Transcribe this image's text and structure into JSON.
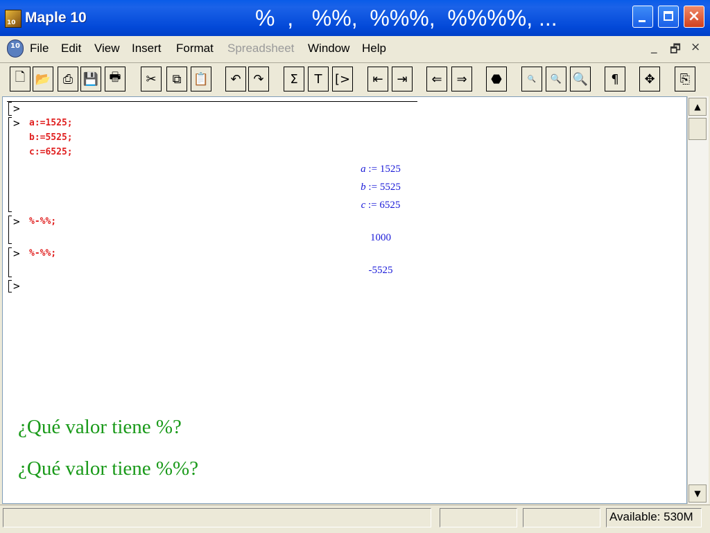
{
  "window": {
    "title": "Maple 10",
    "app_icon_text": "10",
    "slide_title": "%  ,   %%,  %%%,  %%%%, ..."
  },
  "menu": {
    "items": [
      {
        "label": "File",
        "enabled": true
      },
      {
        "label": "Edit",
        "enabled": true
      },
      {
        "label": "View",
        "enabled": true
      },
      {
        "label": "Insert",
        "enabled": true
      },
      {
        "label": "Format",
        "enabled": true
      },
      {
        "label": "Spreadsheet",
        "enabled": false
      },
      {
        "label": "Window",
        "enabled": true
      },
      {
        "label": "Help",
        "enabled": true
      }
    ],
    "mdi_buttons": [
      "_",
      "🗗",
      "×"
    ]
  },
  "toolbar": {
    "buttons": [
      {
        "name": "new-document-icon",
        "glyph": "🗋"
      },
      {
        "name": "open-folder-icon",
        "glyph": "📂"
      },
      {
        "name": "open-url-icon",
        "glyph": "⎙"
      },
      {
        "name": "save-icon",
        "glyph": "💾"
      },
      {
        "name": "print-icon",
        "glyph": "🖶"
      },
      {
        "name": "cut-icon",
        "glyph": "✂"
      },
      {
        "name": "copy-icon",
        "glyph": "⧉"
      },
      {
        "name": "paste-icon",
        "glyph": "📋"
      },
      {
        "name": "undo-icon",
        "glyph": "↶"
      },
      {
        "name": "redo-icon",
        "glyph": "↷"
      },
      {
        "name": "math-input-icon",
        "glyph": "Σ"
      },
      {
        "name": "text-input-icon",
        "glyph": "T"
      },
      {
        "name": "execution-group-icon",
        "glyph": "[>"
      },
      {
        "name": "outdent-icon",
        "glyph": "⇤"
      },
      {
        "name": "indent-icon",
        "glyph": "⇥"
      },
      {
        "name": "back-icon",
        "glyph": "⇐"
      },
      {
        "name": "forward-icon",
        "glyph": "⇒"
      },
      {
        "name": "stop-icon",
        "glyph": "⬣"
      },
      {
        "name": "zoom-small-icon",
        "glyph": "🔍"
      },
      {
        "name": "zoom-medium-icon",
        "glyph": "🔍"
      },
      {
        "name": "zoom-large-icon",
        "glyph": "🔍"
      },
      {
        "name": "show-invisible-icon",
        "glyph": "¶"
      },
      {
        "name": "move-icon",
        "glyph": "✥"
      },
      {
        "name": "restart-icon",
        "glyph": "⎘"
      }
    ]
  },
  "worksheet": {
    "prompt": ">",
    "groups": [
      {
        "inputs": [
          "a:=1525;",
          "b:=5525;",
          "c:=6525;"
        ],
        "outputs": [
          {
            "var": "a",
            "op": ":=",
            "value": "1525"
          },
          {
            "var": "b",
            "op": ":=",
            "value": "5525"
          },
          {
            "var": "c",
            "op": ":=",
            "value": "6525"
          }
        ]
      },
      {
        "inputs": [
          "%-%%;"
        ],
        "outputs": [
          {
            "value": "1000"
          }
        ]
      },
      {
        "inputs": [
          "%-%%;"
        ],
        "outputs": [
          {
            "value": "-5525"
          }
        ]
      }
    ]
  },
  "questions": [
    "¿Qué valor tiene %?",
    "¿Qué valor tiene %%?"
  ],
  "statusbar": {
    "available": "Available: 530M"
  }
}
